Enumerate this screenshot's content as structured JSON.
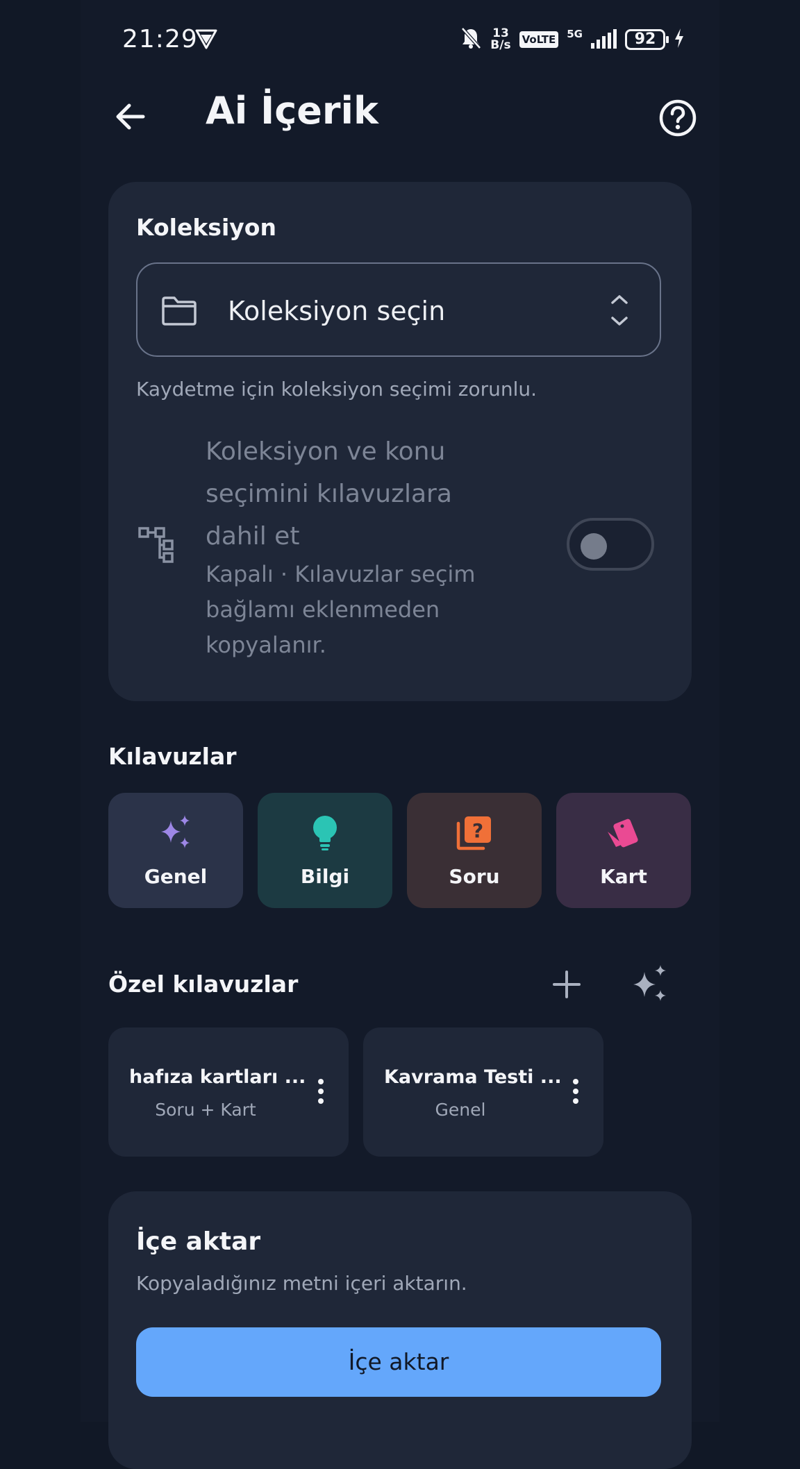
{
  "status_bar": {
    "time": "21:29",
    "net_speed_value": "13",
    "net_speed_unit": "B/s",
    "volte": "VoLTE",
    "network": "5G",
    "battery": "92"
  },
  "header": {
    "title": "Ai İçerik"
  },
  "collection": {
    "label": "Koleksiyon",
    "select_placeholder": "Koleksiyon seçin",
    "helper": "Kaydetme için koleksiyon seçimi zorunlu.",
    "toggle_title": "Koleksiyon ve konu seçimini kılavuzlara dahil et",
    "toggle_subtitle": "Kapalı · Kılavuzlar seçim bağlamı eklenmeden kopyalanır.",
    "toggle_on": false
  },
  "guides": {
    "title": "Kılavuzlar",
    "items": [
      {
        "label": "Genel",
        "icon": "sparkles-icon",
        "color": "#9d87e6"
      },
      {
        "label": "Bilgi",
        "icon": "lightbulb-icon",
        "color": "#2bc4b4"
      },
      {
        "label": "Soru",
        "icon": "question-stack-icon",
        "color": "#f07038"
      },
      {
        "label": "Kart",
        "icon": "cards-icon",
        "color": "#ea4a93"
      }
    ]
  },
  "custom_guides": {
    "title": "Özel kılavuzlar",
    "items": [
      {
        "name": "hafıza kartları ...",
        "type": "Soru + Kart"
      },
      {
        "name": "Kavrama Testi ...",
        "type": "Genel"
      }
    ]
  },
  "import": {
    "title": "İçe aktar",
    "description": "Kopyaladığınız metni içeri aktarın.",
    "button_label": "İçe aktar"
  },
  "colors": {
    "background": "#111826",
    "card": "#1f2738",
    "accent": "#64a7fb"
  }
}
